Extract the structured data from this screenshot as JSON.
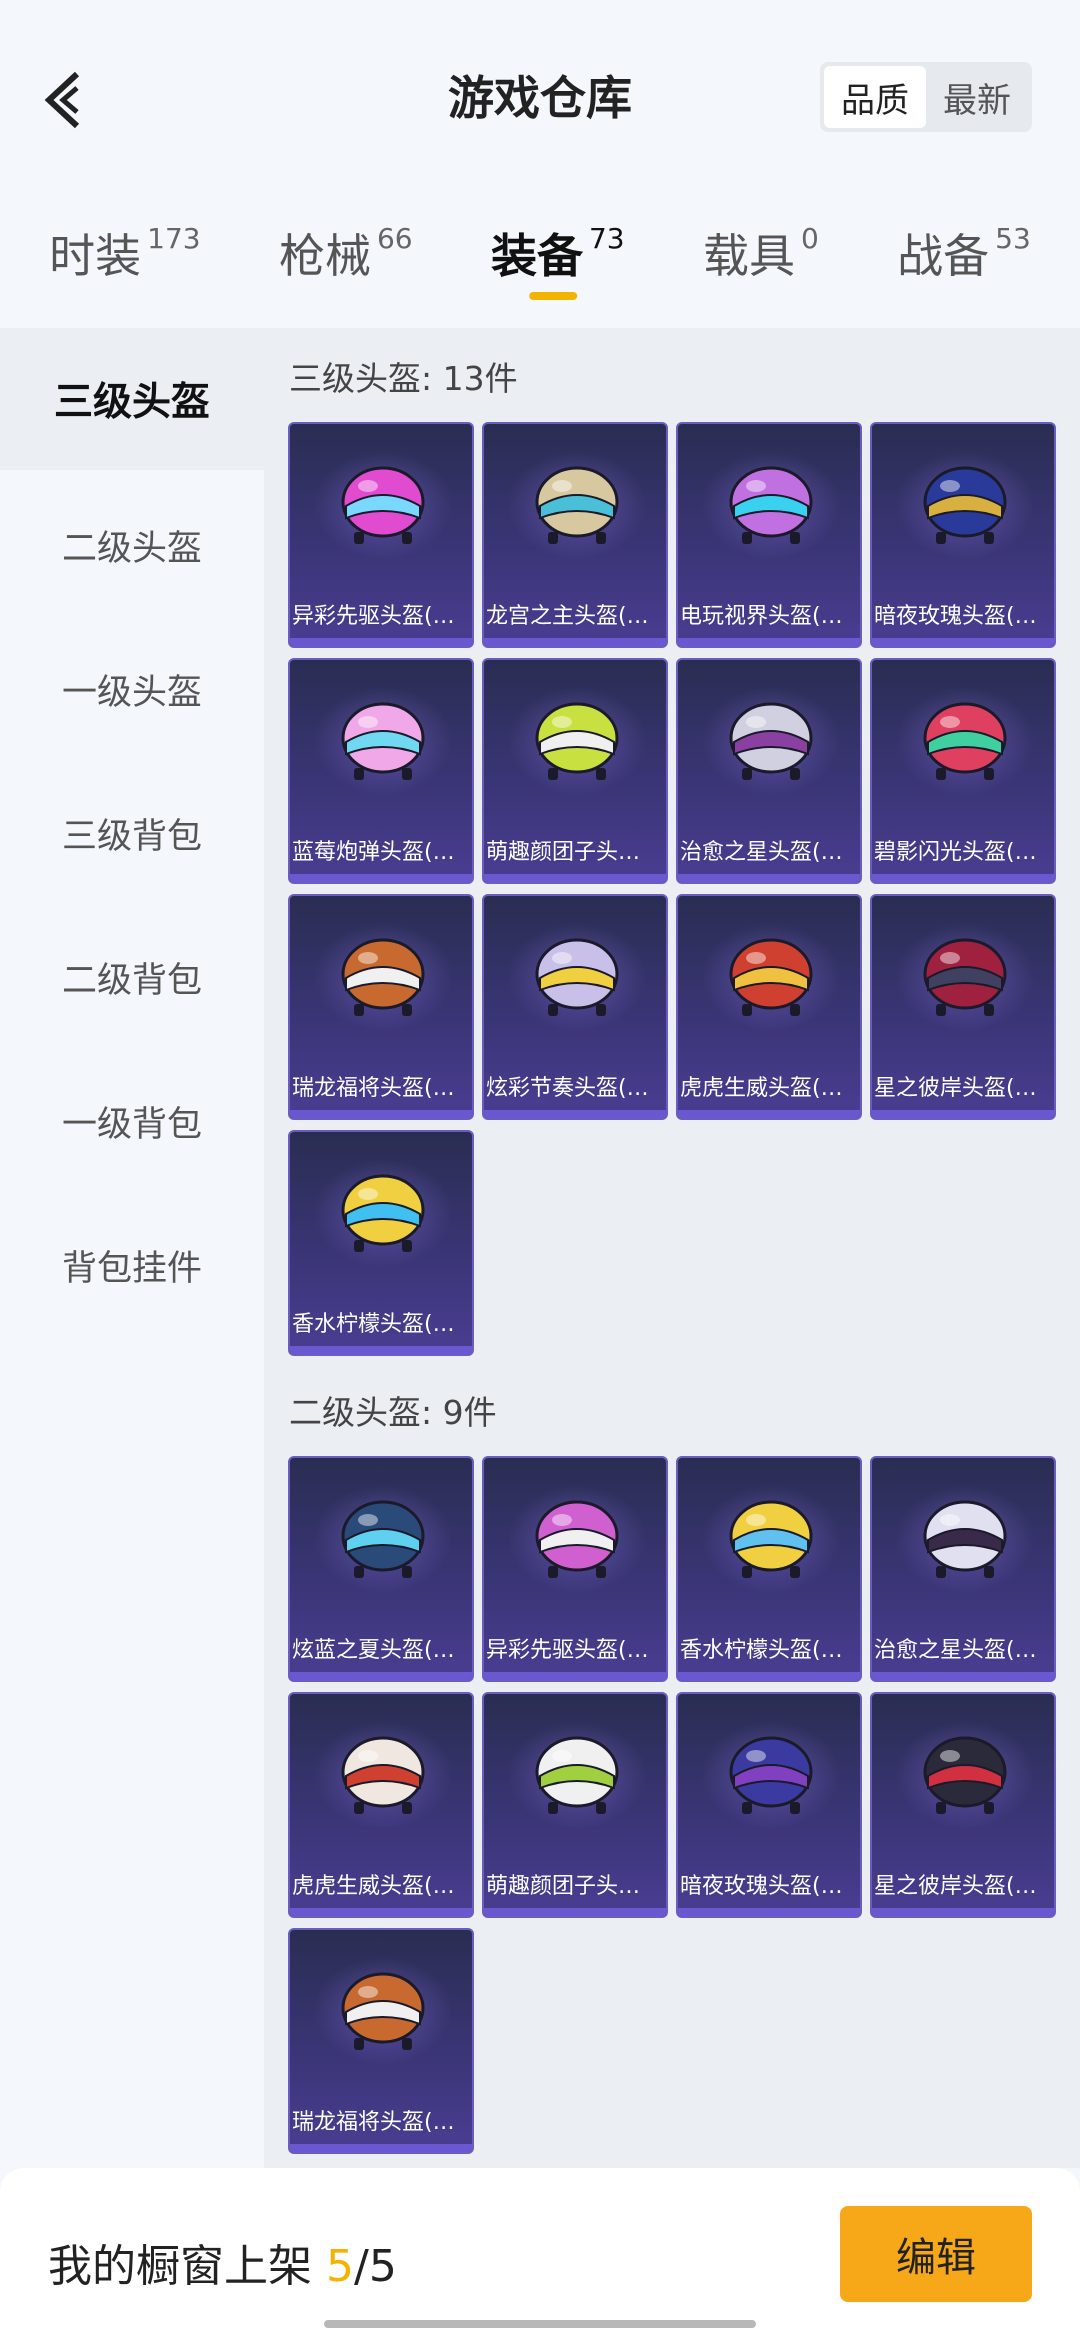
{
  "header": {
    "title": "游戏仓库",
    "sort_options": [
      {
        "label": "品质",
        "active": true
      },
      {
        "label": "最新",
        "active": false
      }
    ]
  },
  "tabs": [
    {
      "label": "时装",
      "count": "173",
      "active": false
    },
    {
      "label": "枪械",
      "count": "66",
      "active": false
    },
    {
      "label": "装备",
      "count": "73",
      "active": true
    },
    {
      "label": "载具",
      "count": "0",
      "active": false
    },
    {
      "label": "战备",
      "count": "53",
      "active": false
    }
  ],
  "sidebar": {
    "items": [
      {
        "label": "三级头盔",
        "active": true
      },
      {
        "label": "二级头盔",
        "active": false
      },
      {
        "label": "一级头盔",
        "active": false
      },
      {
        "label": "三级背包",
        "active": false
      },
      {
        "label": "二级背包",
        "active": false
      },
      {
        "label": "一级背包",
        "active": false
      },
      {
        "label": "背包挂件",
        "active": false
      }
    ]
  },
  "sections": [
    {
      "title": "三级头盔: 13件",
      "items": [
        {
          "name": "异彩先驱头盔(…",
          "color": "#e04bd0",
          "accent": "#7ad8ff"
        },
        {
          "name": "龙宫之主头盔(…",
          "color": "#d8c8a0",
          "accent": "#4ac0d8"
        },
        {
          "name": "电玩视界头盔(…",
          "color": "#c070e0",
          "accent": "#3ad0f0"
        },
        {
          "name": "暗夜玫瑰头盔(…",
          "color": "#2a3a9a",
          "accent": "#d8b040"
        },
        {
          "name": "蓝莓炮弹头盔(…",
          "color": "#f0a8e8",
          "accent": "#70d8f0"
        },
        {
          "name": "萌趣颜团子头…",
          "color": "#c8e040",
          "accent": "#f0f0f0"
        },
        {
          "name": "治愈之星头盔(…",
          "color": "#d0d0e0",
          "accent": "#8a40a0"
        },
        {
          "name": "碧影闪光头盔(…",
          "color": "#e04060",
          "accent": "#40d0a0"
        },
        {
          "name": "瑞龙福将头盔(…",
          "color": "#c86a30",
          "accent": "#f0f0f0"
        },
        {
          "name": "炫彩节奏头盔(…",
          "color": "#c8c0e8",
          "accent": "#f0d040"
        },
        {
          "name": "虎虎生威头盔(…",
          "color": "#d04030",
          "accent": "#f0c040"
        },
        {
          "name": "星之彼岸头盔(…",
          "color": "#a02040",
          "accent": "#404060"
        },
        {
          "name": "香水柠檬头盔(…",
          "color": "#f0d040",
          "accent": "#40c0f0"
        }
      ]
    },
    {
      "title": "二级头盔: 9件",
      "items": [
        {
          "name": "炫蓝之夏头盔(…",
          "color": "#2a4a7a",
          "accent": "#60d0f0"
        },
        {
          "name": "异彩先驱头盔(…",
          "color": "#d060d0",
          "accent": "#f0f0f0"
        },
        {
          "name": "香水柠檬头盔(…",
          "color": "#f0d040",
          "accent": "#60c0f0"
        },
        {
          "name": "治愈之星头盔(…",
          "color": "#e0e0f0",
          "accent": "#3a2a4a"
        },
        {
          "name": "虎虎生威头盔(…",
          "color": "#f0e8e0",
          "accent": "#d04030"
        },
        {
          "name": "萌趣颜团子头…",
          "color": "#f0f0f0",
          "accent": "#a0d040"
        },
        {
          "name": "暗夜玫瑰头盔(…",
          "color": "#3a3aa0",
          "accent": "#8040c0"
        },
        {
          "name": "星之彼岸头盔(…",
          "color": "#2a2a3a",
          "accent": "#d03040"
        },
        {
          "name": "瑞龙福将头盔(…",
          "color": "#c86a30",
          "accent": "#f0f0f0"
        }
      ]
    }
  ],
  "footer": {
    "label": "我的橱窗上架",
    "current": "5",
    "total": "/5",
    "edit_label": "编辑"
  }
}
